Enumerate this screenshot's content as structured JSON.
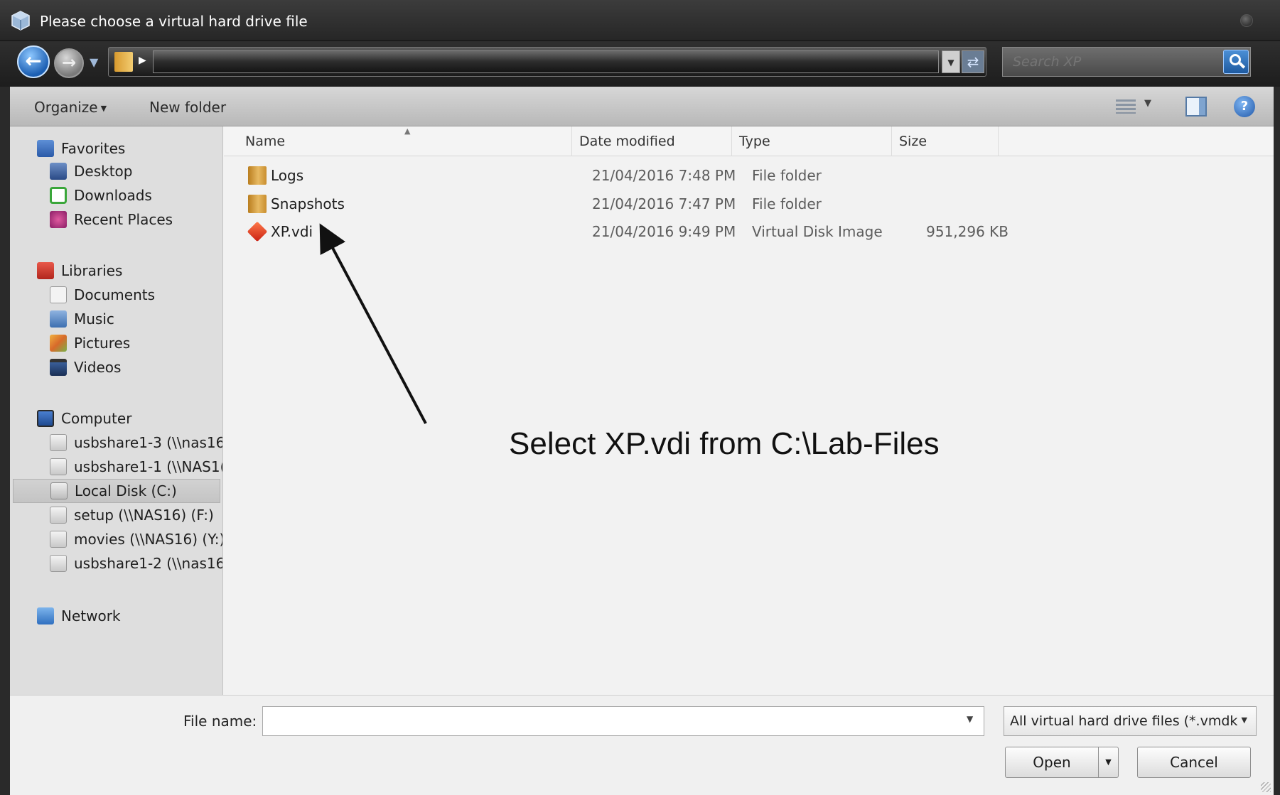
{
  "window": {
    "title": "Please choose a virtual hard drive file"
  },
  "address": {
    "search_placeholder": "Search XP"
  },
  "toolbar": {
    "organize_label": "Organize",
    "new_folder_label": "New folder"
  },
  "nav": {
    "favorites": {
      "label": "Favorites",
      "items": [
        {
          "label": "Desktop",
          "icon": "desktop-icon"
        },
        {
          "label": "Downloads",
          "icon": "downloads-icon"
        },
        {
          "label": "Recent Places",
          "icon": "recent-places-icon"
        }
      ]
    },
    "libraries": {
      "label": "Libraries",
      "items": [
        {
          "label": "Documents",
          "icon": "documents-icon"
        },
        {
          "label": "Music",
          "icon": "music-icon"
        },
        {
          "label": "Pictures",
          "icon": "pictures-icon"
        },
        {
          "label": "Videos",
          "icon": "videos-icon"
        }
      ]
    },
    "computer": {
      "label": "Computer",
      "items": [
        {
          "label": "usbshare1-3 (\\\\nas16",
          "icon": "network-drive-icon"
        },
        {
          "label": "usbshare1-1 (\\\\NAS1(",
          "icon": "network-drive-icon"
        },
        {
          "label": "Local Disk (C:)",
          "icon": "local-disk-icon",
          "selected": true
        },
        {
          "label": "setup (\\\\NAS16) (F:)",
          "icon": "network-drive-icon"
        },
        {
          "label": "movies (\\\\NAS16) (Y:)",
          "icon": "network-drive-icon"
        },
        {
          "label": "usbshare1-2 (\\\\nas16",
          "icon": "network-drive-icon"
        }
      ]
    },
    "network": {
      "label": "Network",
      "icon": "network-icon"
    }
  },
  "columns": {
    "name": "Name",
    "date_modified": "Date modified",
    "type": "Type",
    "size": "Size"
  },
  "files": [
    {
      "name": "Logs",
      "date": "21/04/2016 7:48 PM",
      "type": "File folder",
      "size": "",
      "icon": "folder-icon"
    },
    {
      "name": "Snapshots",
      "date": "21/04/2016 7:47 PM",
      "type": "File folder",
      "size": "",
      "icon": "folder-icon"
    },
    {
      "name": "XP.vdi",
      "date": "21/04/2016 9:49 PM",
      "type": "Virtual Disk Image",
      "size": "951,296 KB",
      "icon": "virtual-disk-icon"
    }
  ],
  "annotation": {
    "text": "Select XP.vdi from C:\\Lab-Files"
  },
  "footer": {
    "file_name_label": "File name:",
    "file_name_value": "",
    "filter_label": "All virtual hard drive files (*.vmdk",
    "open_label": "Open",
    "cancel_label": "Cancel"
  },
  "colors": {
    "title_bar": "#2b2b2b",
    "toolbar": "#c8c8c8",
    "nav_pane": "#dedede",
    "file_pane": "#f2f2f2",
    "accent_blue": "#2b6fc0"
  }
}
